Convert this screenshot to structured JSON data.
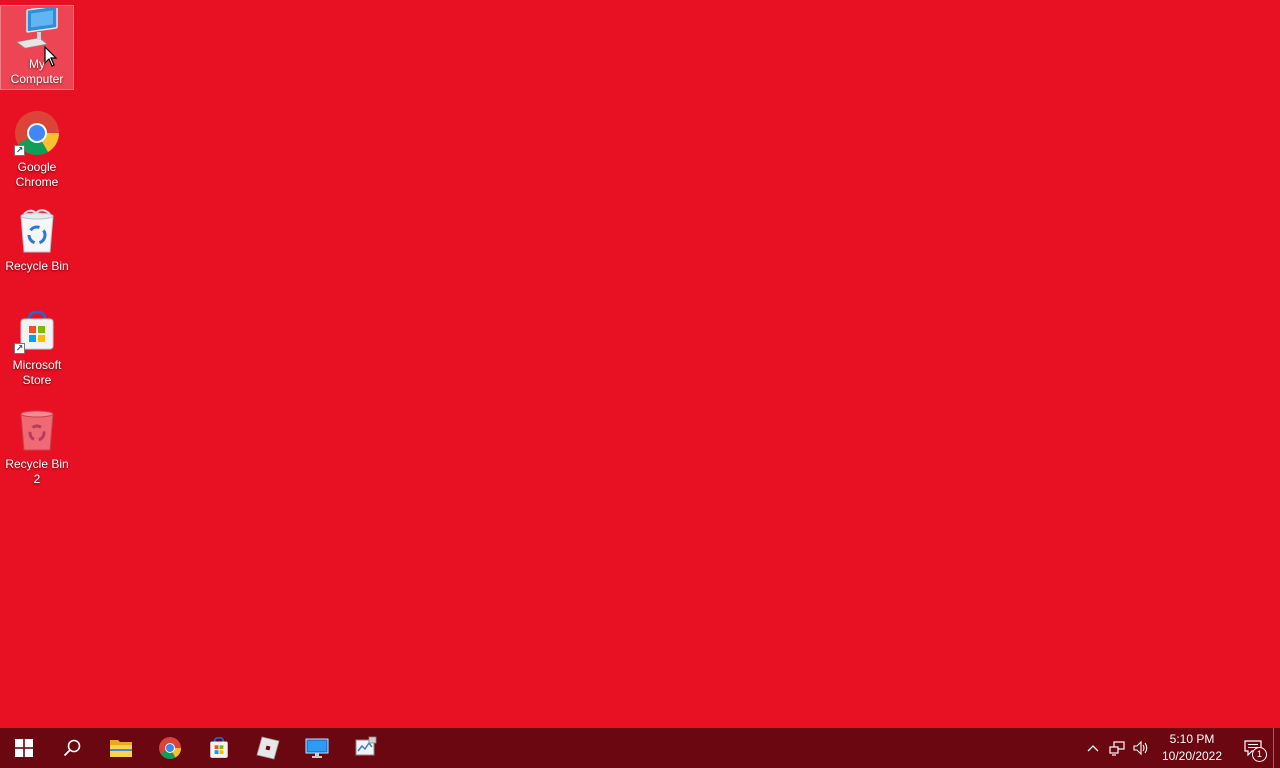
{
  "desktop": {
    "background_color": "#e81123",
    "icons": [
      {
        "label": "My Computer",
        "icon": "computer-icon",
        "selected": true
      },
      {
        "label": "Google Chrome",
        "icon": "chrome-icon",
        "shortcut": true
      },
      {
        "label": "Recycle Bin",
        "icon": "recycle-bin-icon"
      },
      {
        "label": "Microsoft Store",
        "icon": "store-icon",
        "shortcut": true
      },
      {
        "label": "Recycle Bin 2",
        "icon": "recycle-bin-red-icon"
      }
    ]
  },
  "taskbar": {
    "background_color": "#6a0710",
    "buttons": [
      {
        "name": "start-button",
        "icon": "windows-logo-icon"
      },
      {
        "name": "search-button",
        "icon": "search-icon"
      },
      {
        "name": "file-explorer-button",
        "icon": "folder-icon"
      },
      {
        "name": "chrome-button",
        "icon": "chrome-icon"
      },
      {
        "name": "store-button",
        "icon": "store-icon"
      },
      {
        "name": "roblox-button",
        "icon": "roblox-icon"
      },
      {
        "name": "remote-desktop-button",
        "icon": "monitor-icon"
      },
      {
        "name": "app-button",
        "icon": "paint-icon"
      }
    ],
    "tray": {
      "time": "5:10 PM",
      "date": "10/20/2022",
      "notification_count": "1"
    }
  }
}
